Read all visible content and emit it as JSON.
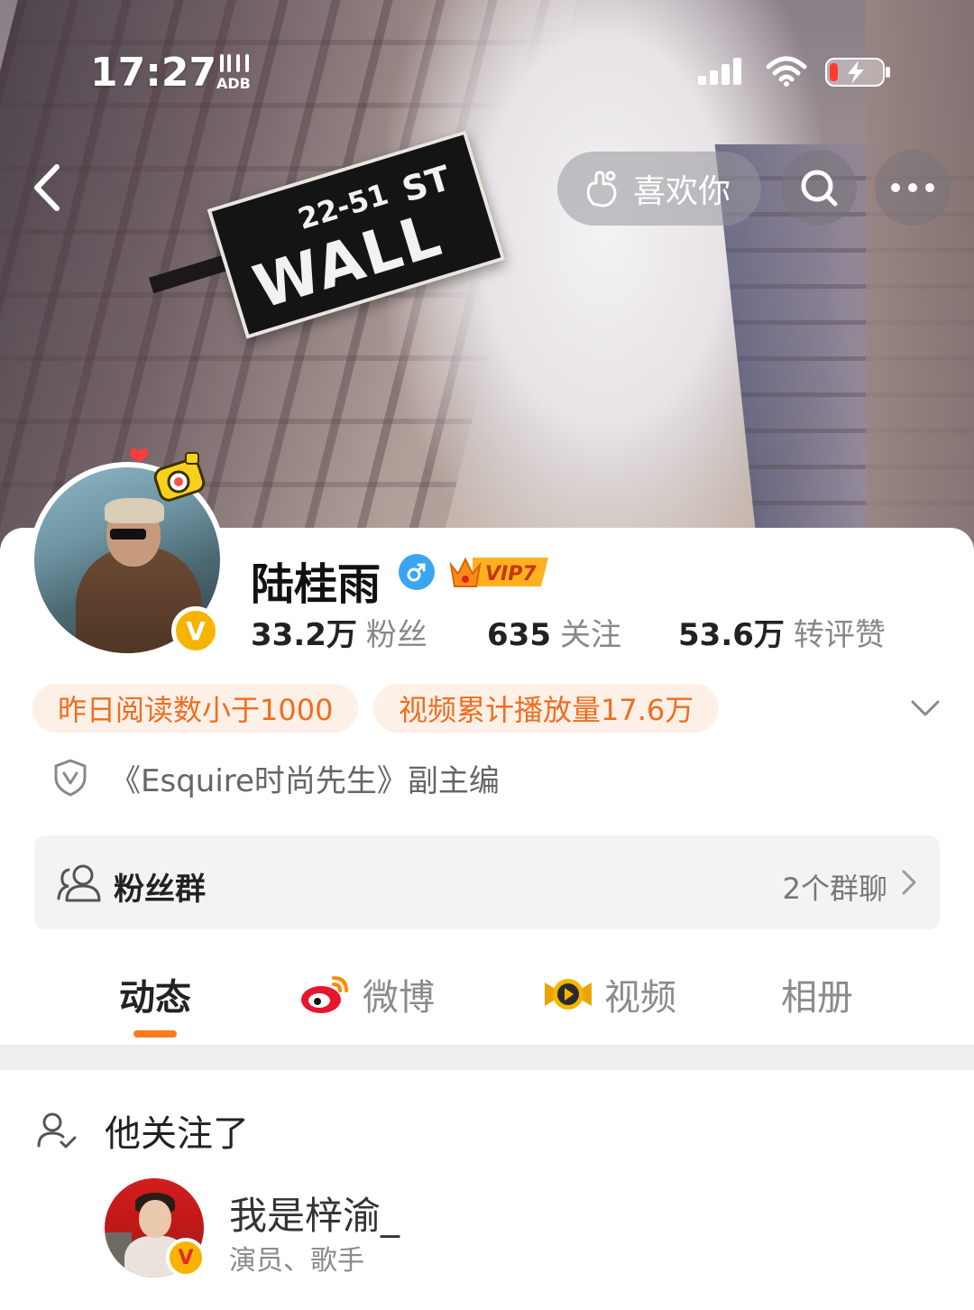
{
  "status_bar": {
    "time": "17:27",
    "extra_label": "ADB",
    "battery_level": 0.15,
    "charging": true
  },
  "nav": {
    "like_label": "喜欢你"
  },
  "cover": {
    "sign_text": "WALL",
    "sign_st": "ST",
    "sign_numbers": "22-51"
  },
  "profile": {
    "name": "陆桂雨",
    "vip_label": "VIP7",
    "verified_label": "V",
    "stats": [
      {
        "num": "33.2万",
        "label": "粉丝"
      },
      {
        "num": "635",
        "label": "关注"
      },
      {
        "num": "53.6万",
        "label": "转评赞"
      }
    ],
    "tags": [
      "昨日阅读数小于1000",
      "视频累计播放量17.6万"
    ],
    "verification": "《Esquire时尚先生》副主编"
  },
  "fan_group": {
    "title": "粉丝群",
    "count": "2个群聊"
  },
  "tabs": [
    {
      "label": "动态",
      "active": true
    },
    {
      "label": "微博",
      "active": false
    },
    {
      "label": "视频",
      "active": false
    },
    {
      "label": "相册",
      "active": false
    }
  ],
  "feed": {
    "header": "他关注了",
    "user": {
      "name": "我是梓渝_",
      "desc": "演员、歌手",
      "verified_label": "V"
    }
  },
  "colors": {
    "accent": "#ff7a1a",
    "tag_text": "#ef6d1f",
    "tag_bg": "#fdf0e7",
    "verified_gold": "#f6b400",
    "male_blue": "#3aa6f2"
  }
}
